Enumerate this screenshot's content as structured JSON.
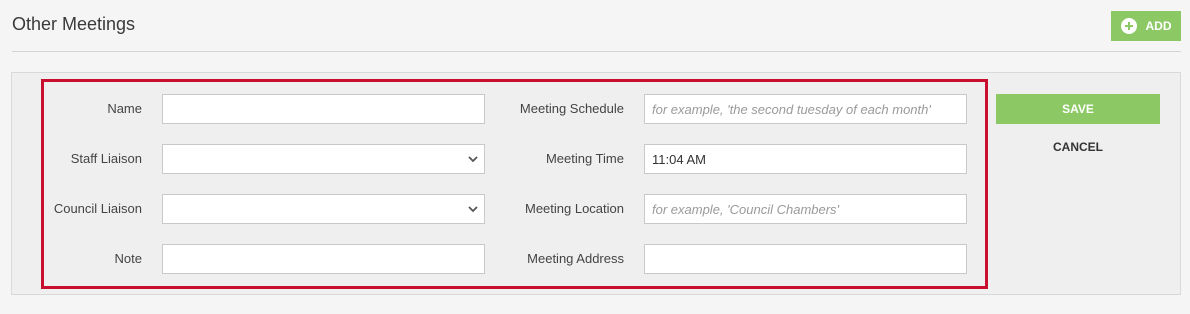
{
  "header": {
    "title": "Other Meetings",
    "add_label": "ADD",
    "add_icon": "plus-circle-icon"
  },
  "form": {
    "name": {
      "label": "Name",
      "value": ""
    },
    "staff_liaison": {
      "label": "Staff Liaison",
      "value": ""
    },
    "council_liaison": {
      "label": "Council Liaison",
      "value": ""
    },
    "note": {
      "label": "Note",
      "value": ""
    },
    "meeting_schedule": {
      "label": "Meeting Schedule",
      "placeholder": "for example, 'the second tuesday of each month'"
    },
    "meeting_time": {
      "label": "Meeting Time",
      "value": "11:04 AM"
    },
    "meeting_location": {
      "label": "Meeting Location",
      "placeholder": "for example, 'Council Chambers'"
    },
    "meeting_address": {
      "label": "Meeting Address",
      "value": ""
    }
  },
  "actions": {
    "save_label": "SAVE",
    "cancel_label": "CANCEL"
  },
  "colors": {
    "accent": "#8cc965",
    "highlight": "#c8102e"
  }
}
